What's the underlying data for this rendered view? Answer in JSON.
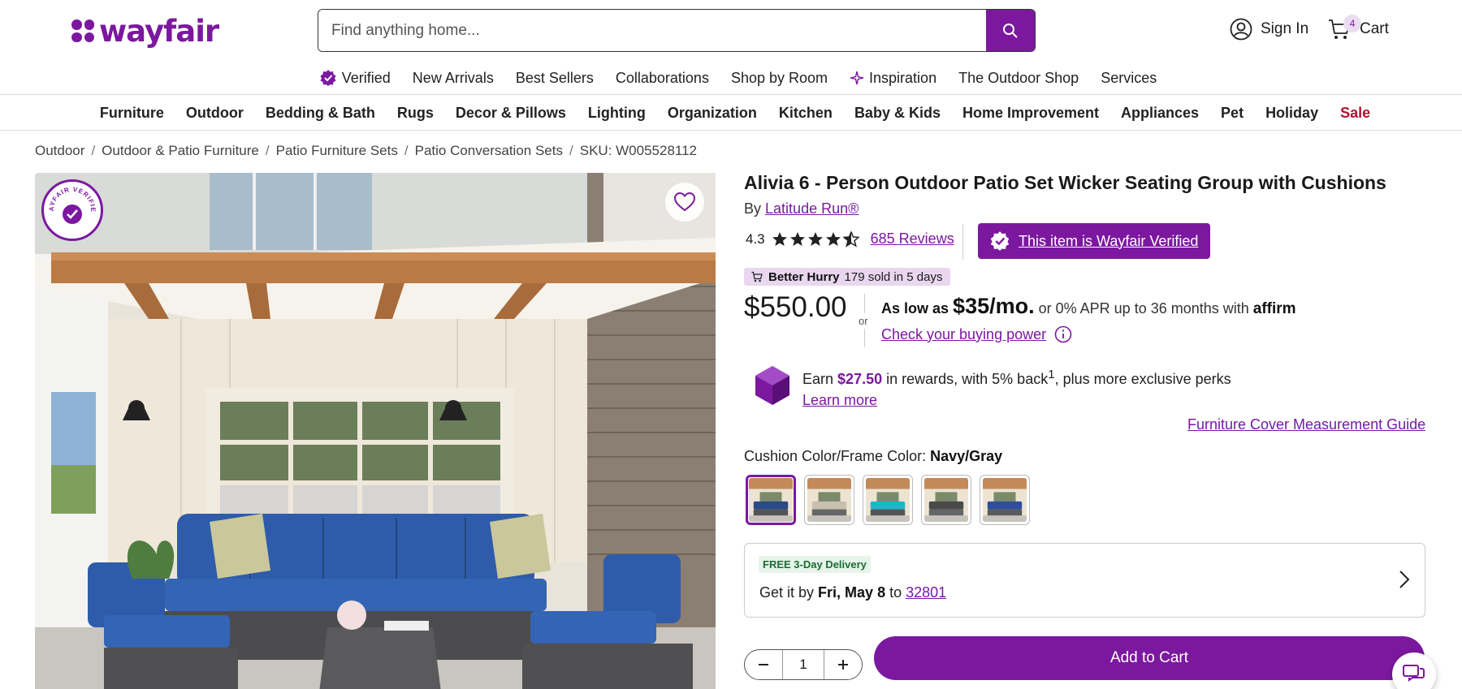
{
  "brand": {
    "logo_text": "wayfair",
    "color": "#7b189f"
  },
  "search": {
    "placeholder": "Find anything home..."
  },
  "account": {
    "sign_in_label": "Sign In"
  },
  "cart": {
    "label": "Cart",
    "count": "4"
  },
  "subnav": {
    "items": [
      "Verified",
      "New Arrivals",
      "Best Sellers",
      "Collaborations",
      "Shop by Room",
      "Inspiration",
      "The Outdoor Shop",
      "Services"
    ]
  },
  "categories": {
    "items": [
      "Furniture",
      "Outdoor",
      "Bedding & Bath",
      "Rugs",
      "Decor & Pillows",
      "Lighting",
      "Organization",
      "Kitchen",
      "Baby & Kids",
      "Home Improvement",
      "Appliances",
      "Pet",
      "Holiday",
      "Sale"
    ]
  },
  "breadcrumb": {
    "items": [
      "Outdoor",
      "Outdoor & Patio Furniture",
      "Patio Furniture Sets",
      "Patio Conversation Sets"
    ],
    "sku": "SKU: W005528112"
  },
  "product": {
    "title": "Alivia 6 - Person Outdoor Patio Set Wicker Seating Group with Cushions",
    "by_prefix": "By",
    "brand_link": "Latitude Run®",
    "rating": "4.3",
    "rating_value": 4.3,
    "reviews_label": "685 Reviews",
    "verified_label": "This item is Wayfair Verified",
    "hurry_bold": "Better Hurry",
    "hurry_text": "179 sold in 5 days",
    "price": "$550.00",
    "or": "or",
    "financing_prefix": "As low as",
    "financing_amount": "$35/mo.",
    "financing_suffix": "or 0% APR up to 36 months with",
    "affirm": "affirm",
    "buying_power": "Check your buying power",
    "rewards_earn": "Earn",
    "rewards_amount": "$27.50",
    "rewards_mid": "in rewards, with 5% back",
    "rewards_sup": "1",
    "rewards_end": ", plus more exclusive perks",
    "learn_more": "Learn more",
    "cover_guide": "Furniture Cover Measurement Guide",
    "color_label": "Cushion Color/Frame Color:",
    "color_value": "Navy/Gray",
    "swatches": [
      {
        "name": "Navy/Gray",
        "cushion": "#2a4a8a",
        "frame": "#555",
        "selected": true
      },
      {
        "name": "Beige/Gray",
        "cushion": "#c9bfae",
        "frame": "#666",
        "selected": false
      },
      {
        "name": "Turquoise/Gray",
        "cushion": "#1fb5c9",
        "frame": "#555",
        "selected": false
      },
      {
        "name": "Dark Gray/Gray",
        "cushion": "#4a4a4a",
        "frame": "#666",
        "selected": false
      },
      {
        "name": "Blue/Gray",
        "cushion": "#2e4f9e",
        "frame": "#5a5a5a",
        "selected": false
      }
    ],
    "delivery_tag": "FREE 3-Day Delivery",
    "delivery_prefix": "Get it by",
    "delivery_date": "Fri, May 8",
    "delivery_to": "to",
    "delivery_zip": "32801",
    "quantity": "1",
    "add_to_cart": "Add to Cart"
  },
  "badge": {
    "text": "WAYFAIR VERIFIED"
  }
}
